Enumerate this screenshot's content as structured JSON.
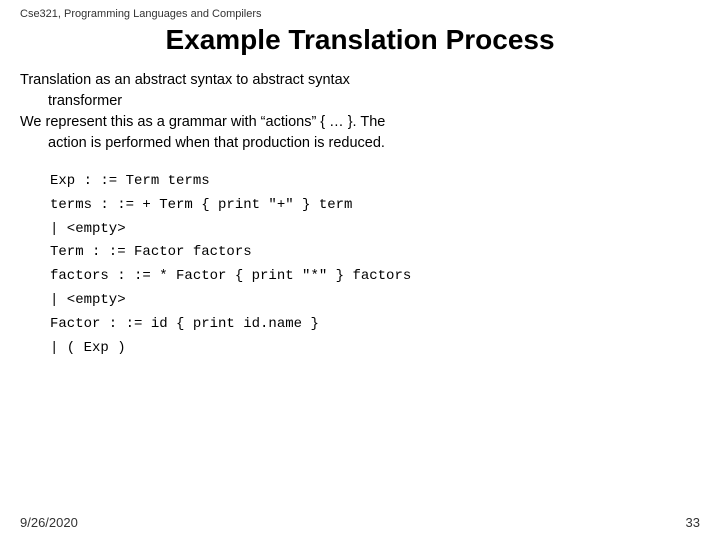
{
  "header": {
    "course_label": "Cse321, Programming Languages and Compilers",
    "title": "Example Translation Process"
  },
  "body": {
    "para1_line1": "Translation as an abstract syntax to abstract syntax",
    "para1_line2": "transformer",
    "para2_line1": "We represent this as a grammar with “actions” { … }.  The",
    "para2_line2": "action is performed when that production is reduced."
  },
  "grammar": {
    "line1": "Exp  : :=  Term terms",
    "line2": "terms  : :=  + Term { print \"+\" } term",
    "line3": "         |  <empty>",
    "line4": "Term  : :=  Factor factors",
    "line5": "factors  : :=  * Factor { print \"*\" } factors",
    "line6": "              |  <empty>",
    "line7": "Factor  : :=  id { print id.name }",
    "line8": "              |  ( Exp )"
  },
  "footer": {
    "date": "9/26/2020",
    "page_number": "33"
  }
}
